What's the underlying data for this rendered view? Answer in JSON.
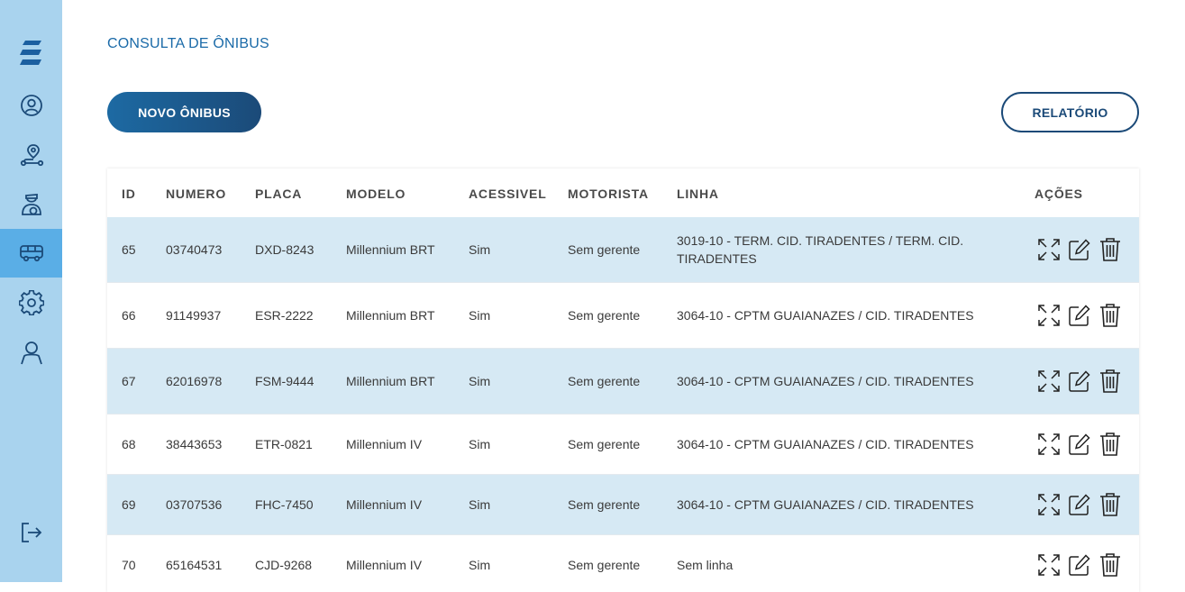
{
  "page": {
    "title": "CONSULTA DE ÔNIBUS"
  },
  "toolbar": {
    "new_label": "NOVO ÔNIBUS",
    "report_label": "RELATÓRIO"
  },
  "sidebar": {
    "items": [
      {
        "icon": "user-circle-icon"
      },
      {
        "icon": "route-pin-icon"
      },
      {
        "icon": "driver-icon"
      },
      {
        "icon": "bus-icon",
        "active": true
      },
      {
        "icon": "gear-icon"
      },
      {
        "icon": "person-icon"
      }
    ],
    "logout_icon": "logout-icon"
  },
  "table": {
    "columns": [
      "ID",
      "NUMERO",
      "PLACA",
      "MODELO",
      "ACESSIVEL",
      "MOTORISTA",
      "LINHA",
      "AÇÕES"
    ],
    "rows": [
      {
        "id": "65",
        "numero": "03740473",
        "placa": "DXD-8243",
        "modelo": "Millennium BRT",
        "acessivel": "Sim",
        "motorista": "Sem gerente",
        "linha": "3019-10 - TERM. CID. TIRADENTES / TERM. CID. TIRADENTES"
      },
      {
        "id": "66",
        "numero": "91149937",
        "placa": "ESR-2222",
        "modelo": "Millennium BRT",
        "acessivel": "Sim",
        "motorista": "Sem gerente",
        "linha": "3064-10 - CPTM GUAIANAZES / CID. TIRADENTES"
      },
      {
        "id": "67",
        "numero": "62016978",
        "placa": "FSM-9444",
        "modelo": "Millennium BRT",
        "acessivel": "Sim",
        "motorista": "Sem gerente",
        "linha": "3064-10 - CPTM GUAIANAZES / CID. TIRADENTES"
      },
      {
        "id": "68",
        "numero": "38443653",
        "placa": "ETR-0821",
        "modelo": "Millennium IV",
        "acessivel": "Sim",
        "motorista": "Sem gerente",
        "linha": "3064-10 - CPTM GUAIANAZES / CID. TIRADENTES"
      },
      {
        "id": "69",
        "numero": "03707536",
        "placa": "FHC-7450",
        "modelo": "Millennium IV",
        "acessivel": "Sim",
        "motorista": "Sem gerente",
        "linha": "3064-10 - CPTM GUAIANAZES / CID. TIRADENTES"
      },
      {
        "id": "70",
        "numero": "65164531",
        "placa": "CJD-9268",
        "modelo": "Millennium IV",
        "acessivel": "Sim",
        "motorista": "Sem gerente",
        "linha": "Sem linha"
      }
    ]
  },
  "colors": {
    "sidebar": "#a9d3ee",
    "sidebar_active": "#5aaee6",
    "accent": "#1b4a78",
    "title": "#1a6aa8",
    "row_alt": "#d6e9f4"
  }
}
